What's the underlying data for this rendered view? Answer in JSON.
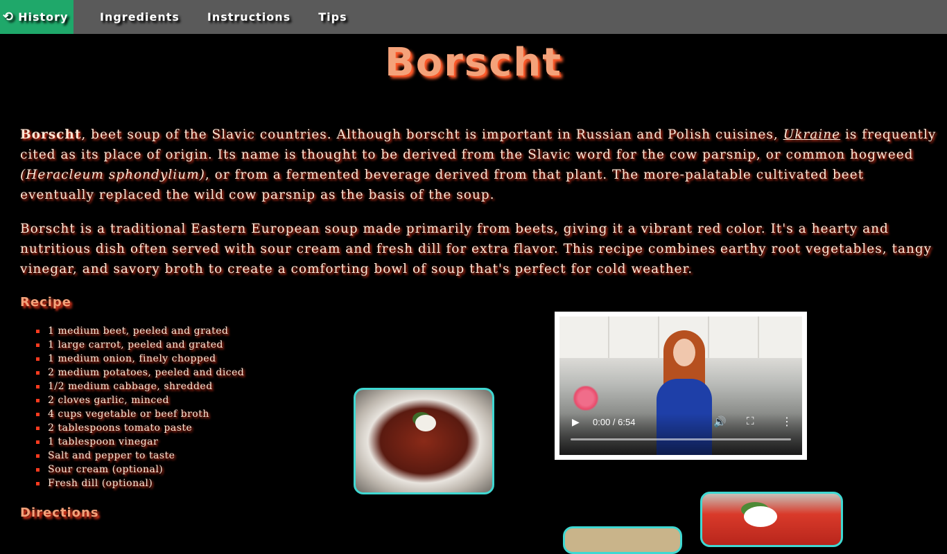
{
  "nav": {
    "items": [
      {
        "label": "History",
        "icon": "history-icon",
        "active": true
      },
      {
        "label": "Ingredients",
        "active": false
      },
      {
        "label": "Instructions",
        "active": false
      },
      {
        "label": "Tips",
        "active": false
      }
    ]
  },
  "title": "Borscht",
  "intro": {
    "bold": "Borscht",
    "part1": ", beet soup of the Slavic countries. Although borscht is important in Russian and Polish cuisines, ",
    "link": "Ukraine",
    "part2": " is frequently cited as its place of origin. Its name is thought to be derived from the Slavic word for the cow parsnip, or common hogweed ",
    "italic": "(Heracleum sphondylium)",
    "part3": ", or from a fermented beverage derived from that plant. The more-palatable cultivated beet eventually replaced the wild cow parsnip as the basis of the soup."
  },
  "description": "Borscht is a traditional Eastern European soup made primarily from beets, giving it a vibrant red color. It's a hearty and nutritious dish often served with sour cream and fresh dill for extra flavor. This recipe combines earthy root vegetables, tangy vinegar, and savory broth to create a comforting bowl of soup that's perfect for cold weather.",
  "recipe": {
    "heading": "Recipe",
    "ingredients": [
      "1 medium beet, peeled and grated",
      "1 large carrot, peeled and grated",
      "1 medium onion, finely chopped",
      "2 medium potatoes, peeled and diced",
      "1/2 medium cabbage, shredded",
      "2 cloves garlic, minced",
      "4 cups vegetable or beef broth",
      "2 tablespoons tomato paste",
      "1 tablespoon vinegar",
      "Salt and pepper to taste",
      "Sour cream (optional)",
      "Fresh dill (optional)"
    ]
  },
  "directions": {
    "heading": "Directions"
  },
  "video": {
    "time": "0:00 / 6:54",
    "progress": 0.0,
    "play_icon": "play-icon",
    "volume_icon": "volume-icon",
    "fullscreen_icon": "fullscreen-icon",
    "more_icon": "more-vert-icon"
  },
  "colors": {
    "nav_bg": "#5a5a5a",
    "nav_active": "#1fa86a",
    "title": "#f4a27a",
    "text_glow": "#ff3b1f",
    "photo_border": "#3fd8d2",
    "background": "#000000"
  }
}
